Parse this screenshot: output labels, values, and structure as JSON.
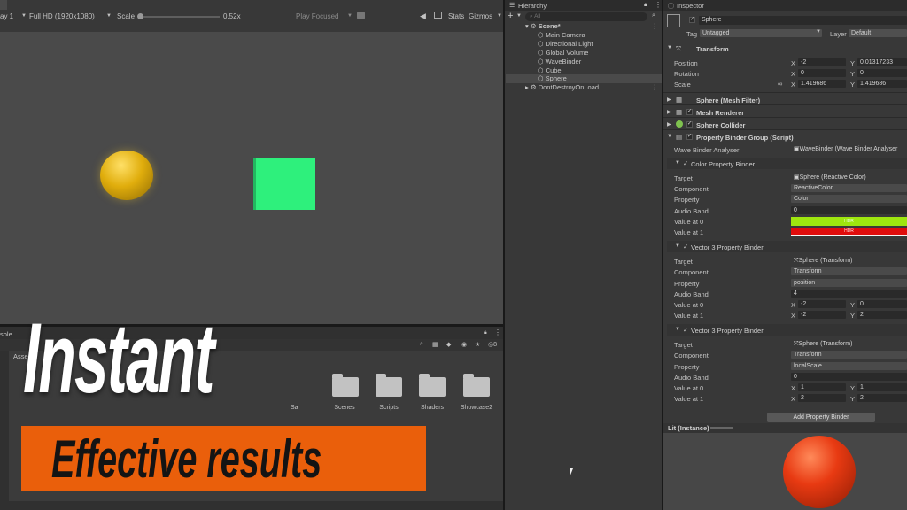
{
  "game_toolbar": {
    "display": "ay 1",
    "resolution": "Full HD (1920x1080)",
    "scale_label": "Scale",
    "scale_value": "0.52x",
    "play_mode": "Play Focused",
    "stats": "Stats",
    "gizmos": "Gizmos"
  },
  "project": {
    "console_tab": "sole",
    "assets_label": "Asse",
    "folders": [
      "Scenes",
      "Scripts",
      "Shaders",
      "Showcase2"
    ],
    "partial_labels": [
      "Sa"
    ],
    "count": "8"
  },
  "hierarchy": {
    "tab": "Hierarchy",
    "search_placeholder": "All",
    "scene": "Scene*",
    "items": [
      "Main Camera",
      "Directional Light",
      "Global Volume",
      "WaveBinder",
      "Cube",
      "Sphere"
    ],
    "dontdestroy": "DontDestroyOnLoad"
  },
  "inspector": {
    "tab": "Inspector",
    "object_name": "Sphere",
    "tag_label": "Tag",
    "tag_value": "Untagged",
    "layer_label": "Layer",
    "layer_value": "Default",
    "transform": {
      "title": "Transform",
      "position_label": "Position",
      "rotation_label": "Rotation",
      "scale_label": "Scale",
      "position": {
        "x": "-2",
        "y": "0.01317233"
      },
      "rotation": {
        "x": "0",
        "y": "0"
      },
      "scale": {
        "x": "1.419686",
        "y": "1.419686"
      }
    },
    "components": {
      "mesh_filter": "Sphere (Mesh Filter)",
      "mesh_renderer": "Mesh Renderer",
      "sphere_collider": "Sphere Collider",
      "property_binder": "Property Binder Group (Script)"
    },
    "wave_binder": {
      "label": "Wave Binder Analyser",
      "value": "WaveBinder (Wave Binder Analyser"
    },
    "color_binder": {
      "title": "Color Property Binder",
      "target_label": "Target",
      "target": "Sphere (Reactive Color)",
      "component_label": "Component",
      "component": "ReactiveColor",
      "property_label": "Property",
      "property": "Color",
      "band_label": "Audio Band",
      "band": "0",
      "v0_label": "Value at 0",
      "v0_text": "HDR",
      "v0_color": "#9ee60f",
      "v1_label": "Value at 1",
      "v1_text": "HDR",
      "v1_color": "#e00c0c"
    },
    "vec_binder_1": {
      "title": "Vector 3 Property Binder",
      "target_label": "Target",
      "target": "Sphere (Transform)",
      "component_label": "Component",
      "component": "Transform",
      "property_label": "Property",
      "property": "position",
      "band_label": "Audio Band",
      "band": "4",
      "v0_label": "Value at 0",
      "v0_x": "-2",
      "v0_y": "0",
      "v1_label": "Value at 1",
      "v1_x": "-2",
      "v1_y": "2"
    },
    "vec_binder_2": {
      "title": "Vector 3 Property Binder",
      "target_label": "Target",
      "target": "Sphere (Transform)",
      "component_label": "Component",
      "component": "Transform",
      "property_label": "Property",
      "property": "localScale",
      "band_label": "Audio Band",
      "band": "0",
      "v0_label": "Value at 0",
      "v0_x": "1",
      "v0_y": "1",
      "v1_label": "Value at 1",
      "v1_x": "2",
      "v1_y": "2"
    },
    "add_button": "Add Property Binder",
    "preview_title": "Lit (Instance)",
    "x": "X",
    "y": "Y"
  },
  "overlay": {
    "title": "Instant",
    "subtitle": "Effective results"
  },
  "colors": {
    "sphere_game": "#e0ad0c",
    "cube": "#2ef07c",
    "preview_sphere": "#e83a12",
    "banner": "#ea5f0b"
  }
}
